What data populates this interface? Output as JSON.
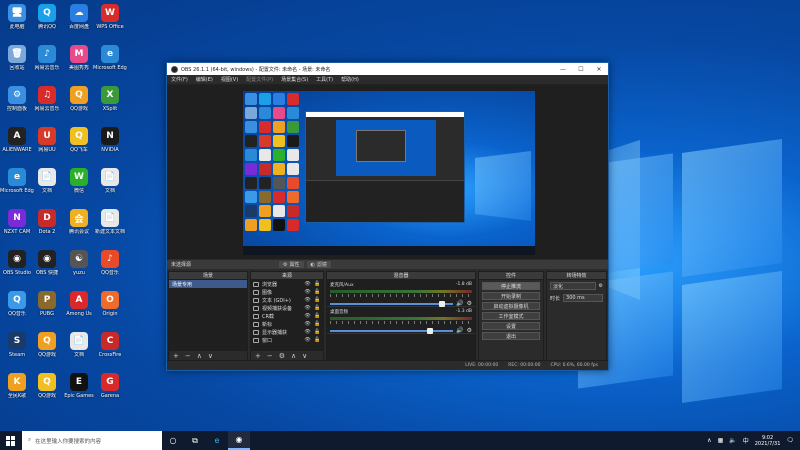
{
  "desktop": {
    "icons": [
      {
        "label": "此电脑",
        "color": "#3b8fe0",
        "glyph": "🖥"
      },
      {
        "label": "腾讯QQ",
        "color": "#1aa0e8",
        "glyph": "Q"
      },
      {
        "label": "百度网盘",
        "color": "#2a7de1",
        "glyph": "☁"
      },
      {
        "label": "WPS Office",
        "color": "#d82b2b",
        "glyph": "W"
      },
      {
        "label": "回收站",
        "color": "#7aa8d8",
        "glyph": "🗑"
      },
      {
        "label": "网易云音乐",
        "color": "#2a8ad8",
        "glyph": "♪"
      },
      {
        "label": "美图秀秀",
        "color": "#e84a8a",
        "glyph": "M"
      },
      {
        "label": "Microsoft Edge",
        "color": "#2a8ad8",
        "glyph": "e"
      },
      {
        "label": "控制面板",
        "color": "#3b8fe0",
        "glyph": "⚙"
      },
      {
        "label": "网易云音乐",
        "color": "#d82b2b",
        "glyph": "♫"
      },
      {
        "label": "QQ游戏",
        "color": "#f0a020",
        "glyph": "Q"
      },
      {
        "label": "XSplit",
        "color": "#3a9a3a",
        "glyph": "X"
      },
      {
        "label": "ALIENWARE",
        "color": "#222",
        "glyph": "A"
      },
      {
        "label": "网易UU",
        "color": "#d83a2a",
        "glyph": "U"
      },
      {
        "label": "QQ飞车",
        "color": "#f0c020",
        "glyph": "Q"
      },
      {
        "label": "NVIDIA",
        "color": "#1a1a1a",
        "glyph": "N"
      },
      {
        "label": "Microsoft Edge",
        "color": "#2a8ad8",
        "glyph": "e"
      },
      {
        "label": "文档",
        "color": "#e8e8e8",
        "glyph": "📄"
      },
      {
        "label": "微信",
        "color": "#2ab02a",
        "glyph": "W"
      },
      {
        "label": "文档",
        "color": "#e8e8e8",
        "glyph": "📄"
      },
      {
        "label": "NZXT CAM",
        "color": "#7a2ad8",
        "glyph": "N"
      },
      {
        "label": "Dota 2",
        "color": "#c82a2a",
        "glyph": "D"
      },
      {
        "label": "腾讯会议",
        "color": "#f0b020",
        "glyph": "会"
      },
      {
        "label": "新建文本文档",
        "color": "#e8e8e8",
        "glyph": "📄"
      },
      {
        "label": "OBS Studio",
        "color": "#222",
        "glyph": "◉"
      },
      {
        "label": "OBS 快捷",
        "color": "#222",
        "glyph": "◉"
      },
      {
        "label": "yuzu",
        "color": "#555",
        "glyph": "☯"
      },
      {
        "label": "QQ音乐",
        "color": "#e84a2a",
        "glyph": "♪"
      },
      {
        "label": "QQ音乐",
        "color": "#3a9ae8",
        "glyph": "Q"
      },
      {
        "label": "PUBG",
        "color": "#8a6a2a",
        "glyph": "P"
      },
      {
        "label": "Among Us",
        "color": "#d82a2a",
        "glyph": "A"
      },
      {
        "label": "Origin",
        "color": "#f06a2a",
        "glyph": "O"
      },
      {
        "label": "Steam",
        "color": "#1a3a6a",
        "glyph": "S"
      },
      {
        "label": "QQ游戏",
        "color": "#f0a020",
        "glyph": "Q"
      },
      {
        "label": "文档",
        "color": "#e8e8e8",
        "glyph": "📄"
      },
      {
        "label": "CrossFire",
        "color": "#c82a2a",
        "glyph": "C"
      },
      {
        "label": "全民K歌",
        "color": "#f0a020",
        "glyph": "K"
      },
      {
        "label": "QQ游戏",
        "color": "#f0c020",
        "glyph": "Q"
      },
      {
        "label": "Epic Games",
        "color": "#111",
        "glyph": "E"
      },
      {
        "label": "Garena",
        "color": "#d82a2a",
        "glyph": "G"
      }
    ]
  },
  "obs": {
    "title": "OBS 26.1.1 (64-bit, windows) - 配置文件: 未命名 - 场景: 未命名",
    "menu": [
      "文件(F)",
      "编辑(E)",
      "视图(V)",
      "配置文件(P)",
      "场景集合(S)",
      "工具(T)",
      "帮助(H)"
    ],
    "dock_header": {
      "scene_label": "未选择源",
      "props_label": "属性",
      "filters_label": "滤镜"
    },
    "panels": {
      "scenes": {
        "title": "场景",
        "items": [
          "场景专用"
        ]
      },
      "sources": {
        "title": "来源",
        "items": [
          {
            "icon": "browser",
            "name": "浏览器"
          },
          {
            "icon": "image",
            "name": "图像"
          },
          {
            "icon": "text",
            "name": "文本 (GDI+)"
          },
          {
            "icon": "camera",
            "name": "视频捕获设备"
          },
          {
            "icon": "media",
            "name": "CR截"
          },
          {
            "icon": "media",
            "name": "新标"
          },
          {
            "icon": "monitor",
            "name": "显示器捕获"
          },
          {
            "icon": "window",
            "name": "窗口"
          }
        ]
      },
      "mixer": {
        "title": "混音器",
        "tracks": [
          {
            "name": "麦克风/Aux",
            "db": "-1.8 dB"
          },
          {
            "name": "桌面音频",
            "db": "-1.3 dB"
          }
        ]
      },
      "controls": {
        "title": "控件",
        "buttons": [
          "停止推流",
          "开始录制",
          "启动虚拟摄像机",
          "工作室模式",
          "设置",
          "退出"
        ]
      },
      "transitions": {
        "title": "转场特效",
        "type": "淡化",
        "duration_label": "时长",
        "duration": "300 ms"
      }
    },
    "status": {
      "live": "LIVE: 00:00:00",
      "rec": "REC: 00:00:00",
      "cpu": "CPU: 0.6%, 60.00 fps"
    }
  },
  "taskbar": {
    "search_placeholder": "在这里输入你要搜索的内容",
    "time": "9:02",
    "date": "2021/7/31"
  }
}
